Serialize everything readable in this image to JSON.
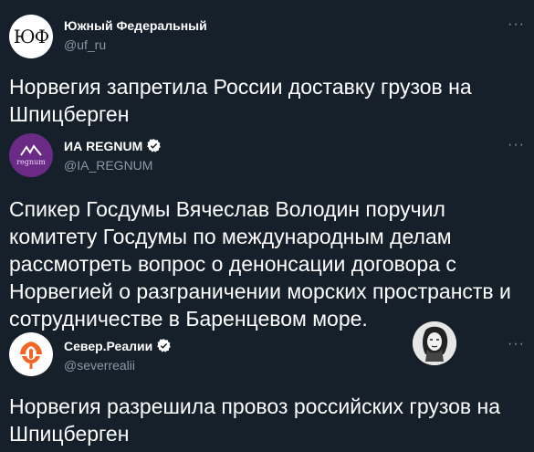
{
  "tweets": [
    {
      "name": "Южный Федеральный",
      "handle": "@uf_ru",
      "avatar_text": "ЮФ",
      "text": "Норвегия запретила России доставку грузов на Шпицберген",
      "verified": false
    },
    {
      "name": "ИА REGNUM",
      "handle": "@IA_REGNUM",
      "avatar_text": "regnum",
      "text": "Спикер Госдумы Вячеслав Володин поручил комитету Госдумы по международным делам рассмотреть вопрос о денонсации договора с Норвегией о разграничении морских пространств и сотрудничестве в Баренцевом море.",
      "verified": true
    },
    {
      "name": "Север.Реалии",
      "handle": "@severrealii",
      "text": "Норвегия разрешила провоз российских грузов на Шпицберген",
      "verified": true
    }
  ],
  "more_label": "···",
  "colors": {
    "background": "#15202b",
    "text": "#ffffff",
    "secondary": "#8b98a5",
    "verified": "#ffffff"
  },
  "icons": [
    "more-options-icon",
    "verified-badge-icon",
    "microphone-logo-icon"
  ]
}
